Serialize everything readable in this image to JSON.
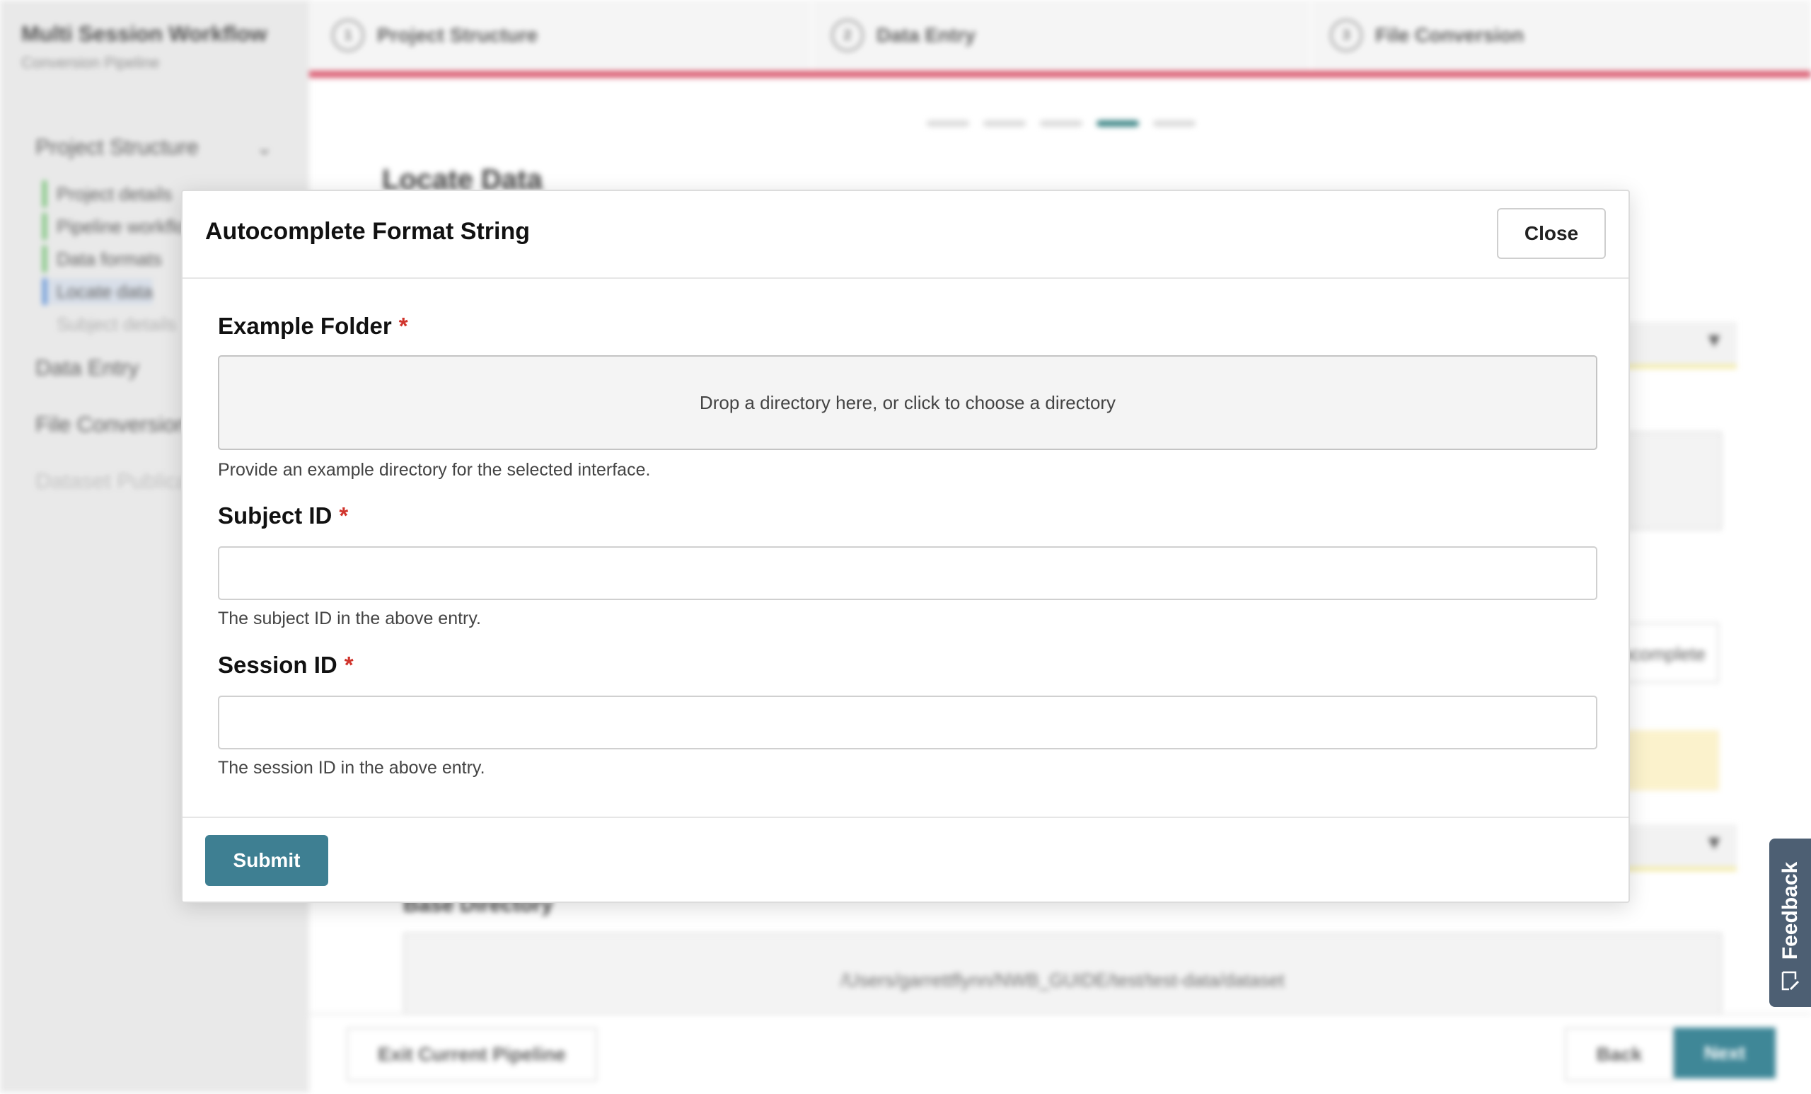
{
  "background": {
    "sidebar": {
      "title": "Multi Session Workflow",
      "subtitle": "Conversion Pipeline",
      "section": "Project Structure",
      "items": [
        "Project details",
        "Pipeline workflow",
        "Data formats",
        "Locate data",
        "Subject details"
      ],
      "links": [
        "Data Entry",
        "File Conversion",
        "Dataset Publication"
      ]
    },
    "steps": [
      {
        "num": "1",
        "label": "Project Structure"
      },
      {
        "num": "2",
        "label": "Data Entry"
      },
      {
        "num": "3",
        "label": "File Conversion"
      }
    ],
    "page_heading": "Locate Data",
    "base_directory_label": "Base Directory",
    "base_directory_value": "/Users/garrettflynn/NWB_GUIDE/test/test-data/dataset",
    "autocomplete_label": "Autocomplete",
    "footer": {
      "exit": "Exit Current Pipeline",
      "back": "Back",
      "next": "Next"
    }
  },
  "modal": {
    "title": "Autocomplete Format String",
    "close_label": "Close",
    "fields": {
      "example_folder": {
        "label": "Example Folder",
        "required_mark": "*",
        "dropzone_text": "Drop a directory here, or click to choose a directory",
        "help": "Provide an example directory for the selected interface."
      },
      "subject_id": {
        "label": "Subject ID",
        "required_mark": "*",
        "value": "",
        "help": "The subject ID in the above entry."
      },
      "session_id": {
        "label": "Session ID",
        "required_mark": "*",
        "value": "",
        "help": "The session ID in the above entry."
      }
    },
    "submit_label": "Submit"
  },
  "feedback_tab": {
    "label": "Feedback",
    "icon": "feedback-edit-icon"
  },
  "colors": {
    "accent": "#3e7f92",
    "required": "#d0342c",
    "stepper_bar": "#d9546a",
    "feedback_tab": "#4d5f73"
  }
}
